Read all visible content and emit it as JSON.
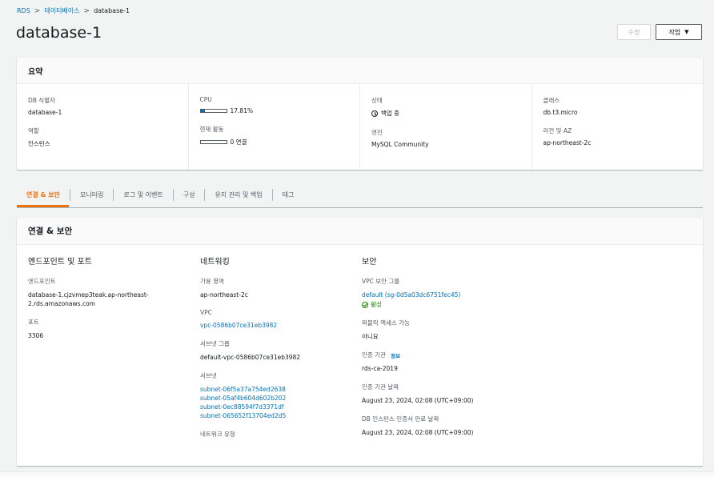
{
  "breadcrumb": {
    "root": "RDS",
    "sep": ">",
    "databases": "데이터베이스",
    "current": "database-1"
  },
  "page_title": "database-1",
  "buttons": {
    "edit": "수정",
    "action": "작업"
  },
  "summary": {
    "title": "요약",
    "db_identifier": {
      "label": "DB 식별자",
      "value": "database-1"
    },
    "role": {
      "label": "역할",
      "value": "인스턴스"
    },
    "cpu": {
      "label": "CPU",
      "value": "17.81%",
      "fraction": 0.1781
    },
    "activity": {
      "label": "현재 활동",
      "value": "0 연결",
      "fraction": 0
    },
    "status": {
      "label": "상태",
      "value": "백업 중"
    },
    "engine": {
      "label": "엔진",
      "value": "MySQL Community"
    },
    "class": {
      "label": "클래스",
      "value": "db.t3.micro"
    },
    "region_az": {
      "label": "리전 및 AZ",
      "value": "ap-northeast-2c"
    }
  },
  "tabs": [
    {
      "label": "연결 & 보안"
    },
    {
      "label": "모니터링"
    },
    {
      "label": "로그 및 이벤트"
    },
    {
      "label": "구성"
    },
    {
      "label": "유지 관리 및 백업"
    },
    {
      "label": "태그"
    }
  ],
  "connectivity": {
    "title": "연결 & 보안",
    "endpoint_col": {
      "title": "엔드포인트 및 포트",
      "endpoint_label": "엔드포인트",
      "endpoint_line1": "database-1.cjzvmep3teak.ap-northeast-",
      "endpoint_line2": "2.rds.amazonaws.com",
      "port_label": "포트",
      "port_value": "3306"
    },
    "network_col": {
      "title": "네트워킹",
      "az_label": "가용 영역",
      "az_value": "ap-northeast-2c",
      "vpc_label": "VPC",
      "vpc_value": "vpc-0586b07ce31eb3982",
      "subnet_group_label": "서브넷 그룹",
      "subnet_group_value": "default-vpc-0586b07ce31eb3982",
      "subnets_label": "서브넷",
      "subnets": [
        "subnet-06f5a37a754ed2638",
        "subnet-05af4b604d602b202",
        "subnet-0ec88594f7d3371df",
        "subnet-065652f13704ed2d5"
      ],
      "network_type_label": "네트워크 유형"
    },
    "security_col": {
      "title": "보안",
      "sg_label": "VPC 보안 그룹",
      "sg_value": "default (sg-0d5a03dc6751fec45)",
      "sg_status": "활성",
      "public_label": "퍼블릭 액세스 가능",
      "public_value": "아니요",
      "ca_label": "인증 기관",
      "ca_info": "정보",
      "ca_value": "rds-ca-2019",
      "ca_date_label": "인증 기관 날짜",
      "ca_date_value": "August 23, 2024, 02:08 (UTC+09:00)",
      "cert_expiry_label": "DB 인스턴스 인증서 만료 날짜",
      "cert_expiry_value": "August 23, 2024, 02:08 (UTC+09:00)"
    }
  }
}
